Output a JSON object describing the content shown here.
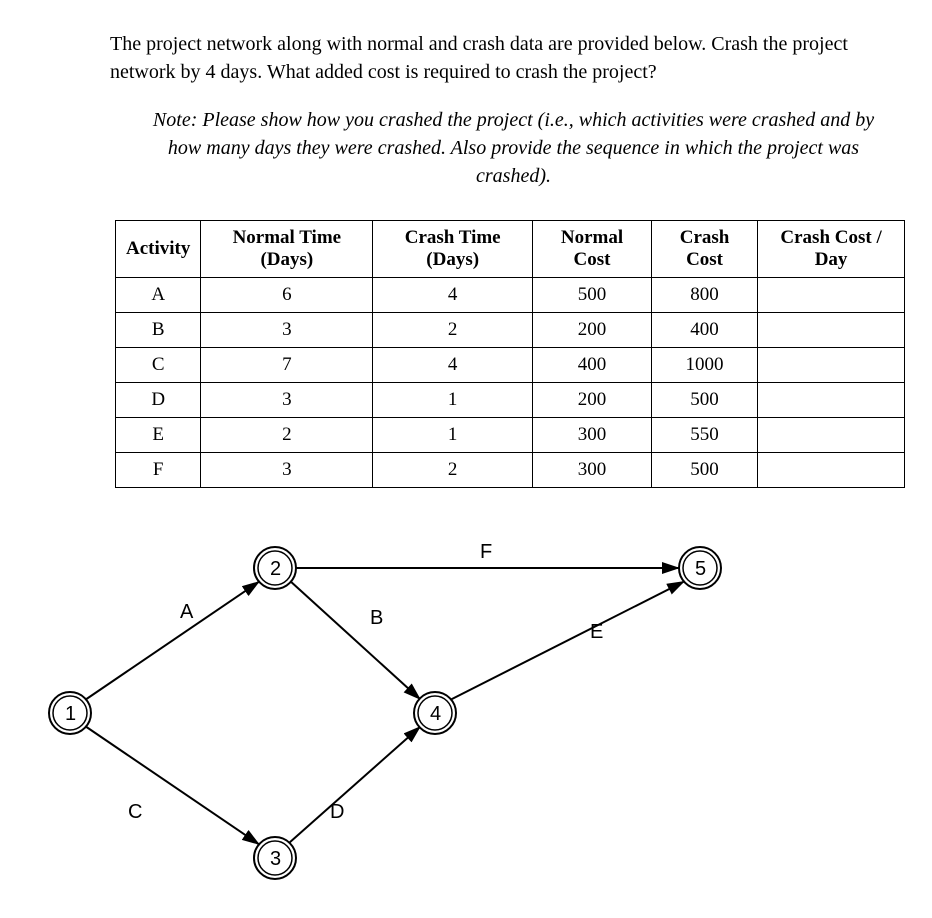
{
  "question": "The project network along with normal and crash data are provided below. Crash the project network by 4 days. What added cost is required to crash the project?",
  "note": "Note: Please show how you crashed the project (i.e., which activities were crashed and by how many days they were crashed. Also provide the sequence in which the project was crashed).",
  "headers": {
    "activity": "Activity",
    "normalTime": "Normal Time (Days)",
    "crashTime": "Crash Time (Days)",
    "normalCost": "Normal Cost",
    "crashCost": "Crash Cost",
    "crashCostDay": "Crash Cost / Day"
  },
  "rows": [
    {
      "activity": "A",
      "normalTime": "6",
      "crashTime": "4",
      "normalCost": "500",
      "crashCost": "800",
      "crashCostDay": ""
    },
    {
      "activity": "B",
      "normalTime": "3",
      "crashTime": "2",
      "normalCost": "200",
      "crashCost": "400",
      "crashCostDay": ""
    },
    {
      "activity": "C",
      "normalTime": "7",
      "crashTime": "4",
      "normalCost": "400",
      "crashCost": "1000",
      "crashCostDay": ""
    },
    {
      "activity": "D",
      "normalTime": "3",
      "crashTime": "1",
      "normalCost": "200",
      "crashCost": "500",
      "crashCostDay": ""
    },
    {
      "activity": "E",
      "normalTime": "2",
      "crashTime": "1",
      "normalCost": "300",
      "crashCost": "550",
      "crashCostDay": ""
    },
    {
      "activity": "F",
      "normalTime": "3",
      "crashTime": "2",
      "normalCost": "300",
      "crashCost": "500",
      "crashCostDay": ""
    }
  ],
  "nodes": {
    "n1": "1",
    "n2": "2",
    "n3": "3",
    "n4": "4",
    "n5": "5"
  },
  "edges": {
    "A": "A",
    "B": "B",
    "C": "C",
    "D": "D",
    "E": "E",
    "F": "F"
  }
}
